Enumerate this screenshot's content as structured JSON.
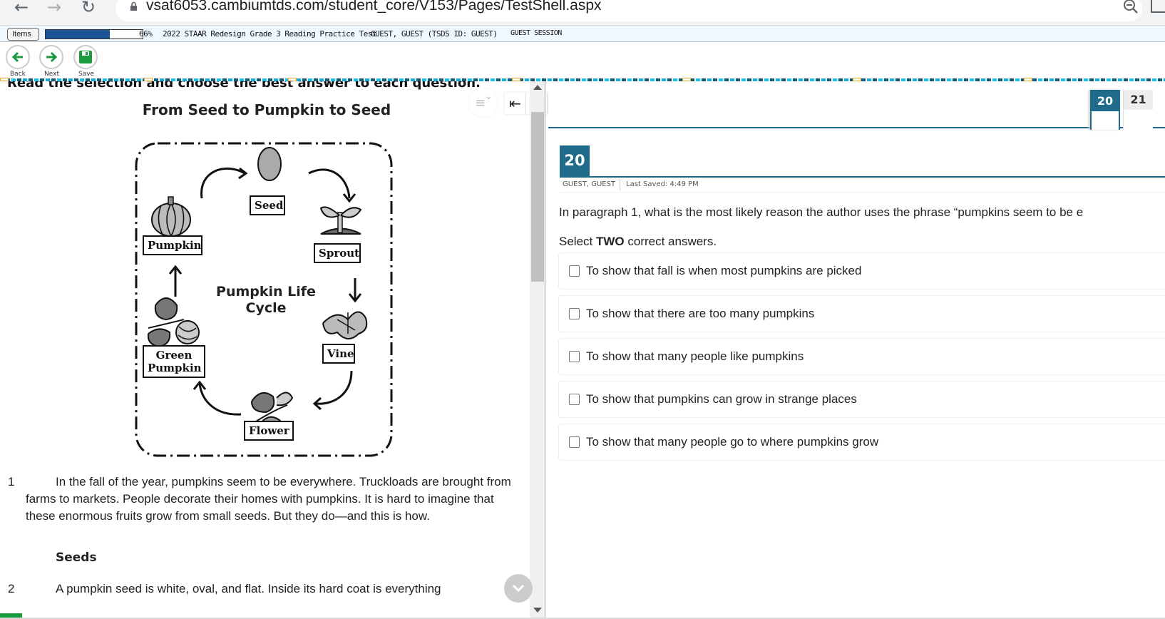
{
  "browser": {
    "url": "vsat6053.cambiumtds.com/student_core/V153/Pages/TestShell.aspx",
    "icons": [
      "back-arrow-icon",
      "forward-arrow-icon",
      "reload-icon",
      "lock-icon",
      "zoom-out-icon",
      "extension-icon"
    ]
  },
  "testbar": {
    "items_label": "Items",
    "progress_percent": 66,
    "progress_label": "66%",
    "test_name": "2022 STAAR Redesign Grade 3 Reading Practice Test",
    "student": "GUEST, GUEST (TSDS ID: GUEST)",
    "session": "GUEST SESSION"
  },
  "toolbar": {
    "back_label": "Back",
    "next_label": "Next",
    "save_label": "Save"
  },
  "passage": {
    "instructions": "Read the selection and choose the best answer to each question.",
    "title": "From Seed to Pumpkin to Seed",
    "diagram": {
      "center_line1": "Pumpkin Life",
      "center_line2": "Cycle",
      "stages": {
        "seed": "Seed",
        "sprout": "Sprout",
        "vine": "Vine",
        "flower": "Flower",
        "green_pumpkin_1": "Green",
        "green_pumpkin_2": "Pumpkin",
        "pumpkin": "Pumpkin"
      }
    },
    "paragraphs": [
      {
        "num": "1",
        "text": "In the fall of the year, pumpkins seem to be everywhere. Truckloads are brought from farms to markets. People decorate their homes with pumpkins. It is hard to imagine that these enormous fruits grow from small seeds. But they do—and this is how."
      },
      {
        "num": "2",
        "text": "A pumpkin seed is white, oval, and flat. Inside its hard coat is everything"
      }
    ],
    "subheading": "Seeds"
  },
  "question": {
    "tabs": [
      {
        "label": "20",
        "active": true
      },
      {
        "label": "21",
        "active": false
      }
    ],
    "number": "20",
    "student": "GUEST, GUEST",
    "last_saved": "Last Saved: 4:49 PM",
    "stem": "In paragraph 1, what is the most likely reason the author uses the phrase “pumpkins seem to be e",
    "instruction_prefix": "Select ",
    "instruction_bold": "TWO",
    "instruction_suffix": " correct answers.",
    "options": [
      {
        "text": "To show that fall is when most pumpkins are picked",
        "checked": false
      },
      {
        "text": "To show that there are too many pumpkins",
        "checked": false
      },
      {
        "text": "To show that many people like pumpkins",
        "checked": false
      },
      {
        "text": "To show that pumpkins can grow in strange places",
        "checked": false
      },
      {
        "text": "To show that many people go to where pumpkins grow",
        "checked": false
      }
    ]
  },
  "colors": {
    "accent": "#206a8a",
    "progress": "#1b5594",
    "nav_green": "#1a9c3e"
  }
}
